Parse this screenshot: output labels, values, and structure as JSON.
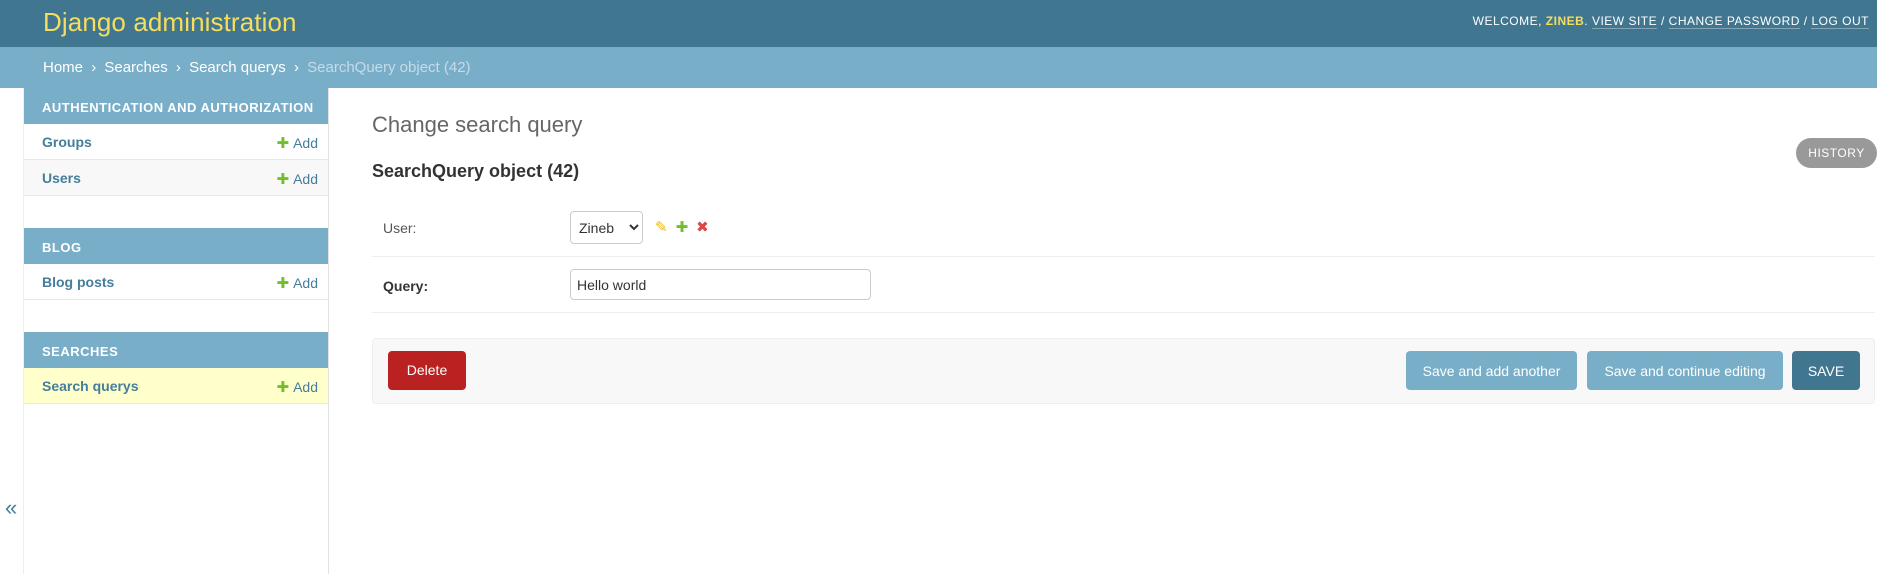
{
  "header": {
    "brand": "Django administration",
    "welcome": "WELCOME, ",
    "username": "ZINEB",
    "view_site": "VIEW SITE",
    "change_password": "CHANGE PASSWORD",
    "log_out": "LOG OUT",
    "separator": " / "
  },
  "breadcrumbs": {
    "home": "Home",
    "app": "Searches",
    "model": "Search querys",
    "current": "SearchQuery object (42)",
    "arrow": "›"
  },
  "sidebar": {
    "modules": [
      {
        "caption": "Authentication and Authorization",
        "items": [
          {
            "label": "Groups",
            "add": "Add"
          },
          {
            "label": "Users",
            "add": "Add"
          }
        ]
      },
      {
        "caption": "Blog",
        "items": [
          {
            "label": "Blog posts",
            "add": "Add"
          }
        ]
      },
      {
        "caption": "Searches",
        "items": [
          {
            "label": "Search querys",
            "add": "Add",
            "selected": true
          }
        ]
      }
    ],
    "toggle": "«"
  },
  "main": {
    "title": "Change search query",
    "object_title": "SearchQuery object (42)",
    "history": "History",
    "fields": {
      "user_label": "User:",
      "user_value": "Zineb",
      "query_label": "Query:",
      "query_value": "Hello world"
    },
    "buttons": {
      "delete": "Delete",
      "save_add_another": "Save and add another",
      "save_continue": "Save and continue editing",
      "save": "SAVE"
    }
  },
  "colors": {
    "header_bg": "#417690",
    "breadcrumbs_bg": "#79aec8",
    "brand": "#f5dd5d",
    "delete": "#ba2121",
    "selected_row": "#ffffcc"
  },
  "icons": {
    "plus": "✚",
    "pencil": "✎",
    "cross": "✖"
  }
}
